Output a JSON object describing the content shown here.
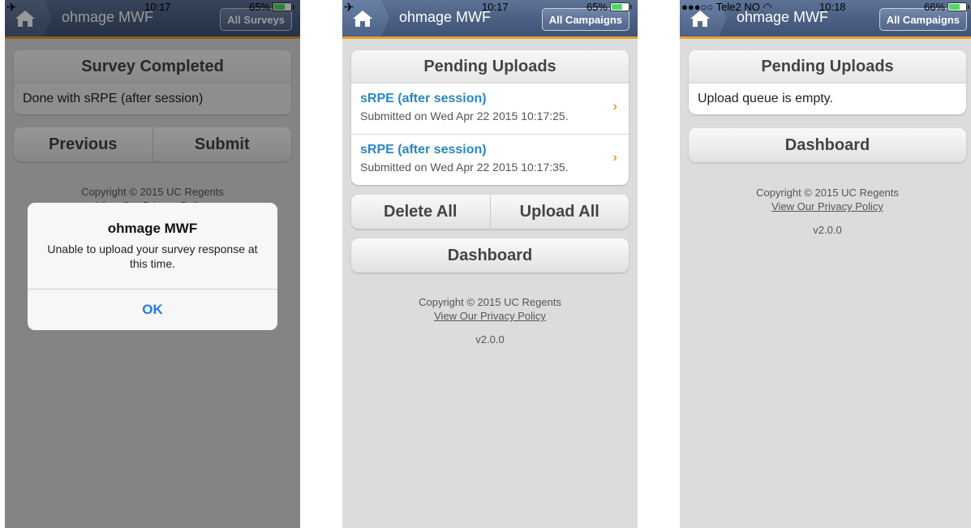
{
  "screen1": {
    "header": {
      "title": "ohmage MWF",
      "right_button": "All Surveys"
    },
    "status": {
      "time": "10:17",
      "battery": "65%",
      "battery_level": 0.65
    },
    "panel": {
      "title": "Survey Completed",
      "text": "Done with sRPE (after session)"
    },
    "buttons": {
      "previous": "Previous",
      "submit": "Submit"
    },
    "footer": {
      "copyright": "Copyright © 2015 UC Regents",
      "privacy": "View Our Privacy Policy"
    },
    "alert": {
      "title": "ohmage MWF",
      "message": "Unable to upload your survey response at this time.",
      "ok": "OK"
    }
  },
  "screen2": {
    "header": {
      "title": "ohmage MWF",
      "right_button": "All Campaigns"
    },
    "status": {
      "time": "10:17",
      "battery": "65%",
      "battery_level": 0.65
    },
    "panel": {
      "title": "Pending Uploads"
    },
    "uploads": [
      {
        "name": "sRPE (after session)",
        "submitted": "Submitted on Wed Apr 22 2015 10:17:25."
      },
      {
        "name": "sRPE (after session)",
        "submitted": "Submitted on Wed Apr 22 2015 10:17:35."
      }
    ],
    "buttons": {
      "delete_all": "Delete All",
      "upload_all": "Upload All",
      "dashboard": "Dashboard"
    },
    "footer": {
      "copyright": "Copyright © 2015 UC Regents",
      "privacy": "View Our Privacy Policy",
      "version": "v2.0.0"
    }
  },
  "screen3": {
    "header": {
      "title": "ohmage MWF",
      "right_button": "All Campaigns"
    },
    "status": {
      "carrier": "●●●○○ Tele2 NO",
      "time": "10:18",
      "battery": "66%",
      "battery_level": 0.66
    },
    "panel": {
      "title": "Pending Uploads",
      "text": "Upload queue is empty."
    },
    "buttons": {
      "dashboard": "Dashboard"
    },
    "footer": {
      "copyright": "Copyright © 2015 UC Regents",
      "privacy": "View Our Privacy Policy",
      "version": "v2.0.0"
    }
  },
  "icons": {
    "home": "home-icon",
    "chevron": "chevron-right-icon",
    "airplane": "airplane-icon",
    "battery": "battery-icon",
    "wifi": "wifi-icon"
  },
  "colors": {
    "header": "#4a5f82",
    "header_accent": "#e8a228",
    "link": "#2a87c0",
    "alert_button": "#1f7ddb",
    "background": "#dcdcdc"
  }
}
